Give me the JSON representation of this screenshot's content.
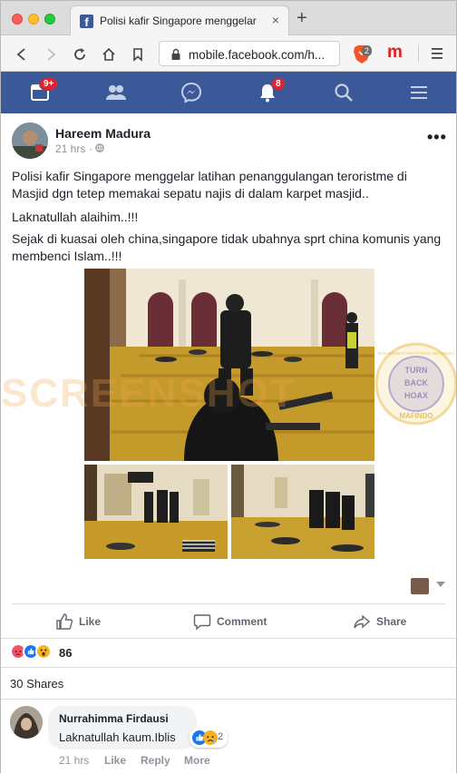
{
  "browser": {
    "tab_title": "Polisi kafir Singapore menggelar latihan",
    "tab_close": "×",
    "new_tab": "+",
    "url": "mobile.facebook.com/h...",
    "brave_count": "2",
    "ext_label": "m"
  },
  "fb_nav": {
    "home_badge": "9+",
    "notifications_badge": "8"
  },
  "post": {
    "author": "Hareem Madura",
    "time": "21 hrs",
    "separator": "·",
    "paragraphs": [
      "Polisi kafir Singapore menggelar latihan penanggulangan teroristme di Masjid dgn tetep memakai sepatu najis di dalam karpet masjid..",
      "Laknatullah alaihim..!!!",
      "Sejak di kuasai oleh china,singapore tidak ubahnya sprt china komunis yang membenci Islam..!!!"
    ],
    "watermark_text": "SCREENSHOT",
    "seal": {
      "top_text": "MASYARAKAT ANTI FITNAH INDONESIA",
      "center_text": [
        "TURN",
        "BACK",
        "HOAX"
      ],
      "bottom_text": "MAFINDO"
    },
    "actions": {
      "like": "Like",
      "comment": "Comment",
      "share": "Share"
    },
    "reaction_count": "86",
    "shares": "30 Shares"
  },
  "comment": {
    "name": "Nurrahimma Firdausi",
    "text": "Laknatullah kaum.Iblis",
    "reaction_count": "2",
    "time": "21 hrs",
    "like": "Like",
    "reply": "Reply",
    "more": "More"
  },
  "colors": {
    "fb_blue": "#3b5998",
    "badge_red": "#e4222e",
    "angry": "#f25268",
    "like_blue": "#1877f2",
    "wow_yellow": "#f7b125"
  }
}
